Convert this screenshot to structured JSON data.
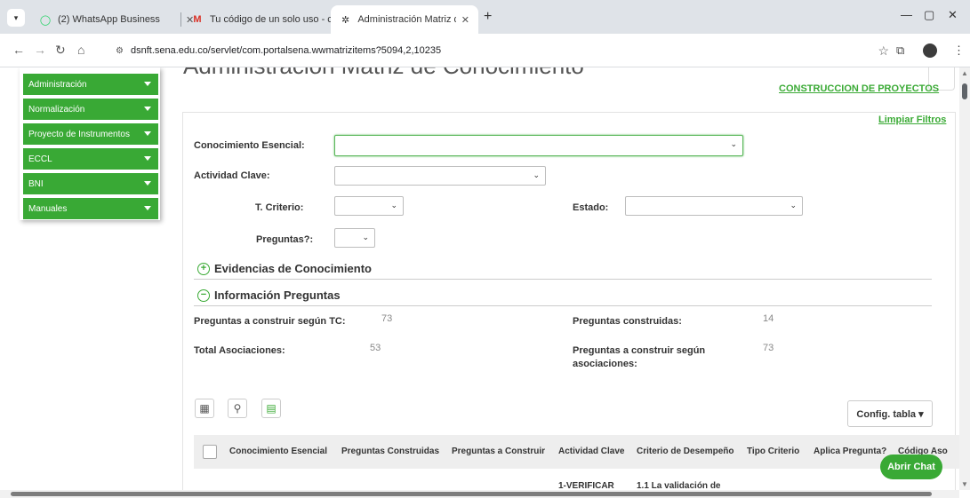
{
  "browser": {
    "tabs": [
      {
        "title": "(2) WhatsApp Business",
        "icon": "whatsapp-icon"
      },
      {
        "title": "Tu código de un solo uso - cla",
        "icon": "gmail-icon"
      },
      {
        "title": "Administración Matriz de Cono",
        "icon": "sena-icon"
      }
    ],
    "url": "dsnft.sena.edu.co/servlet/com.portalsena.wwmatrizitems?5094,2,10235"
  },
  "page": {
    "title": "Administración Matriz de Conocimiento",
    "project_link": "CONSTRUCCION DE PROYECTOS",
    "clear_filters": "Limpiar Filtros"
  },
  "sidebar": {
    "items": [
      {
        "label": "Administración"
      },
      {
        "label": "Normalización"
      },
      {
        "label": "Proyecto de Instrumentos"
      },
      {
        "label": "ECCL"
      },
      {
        "label": "BNI"
      },
      {
        "label": "Manuales"
      }
    ]
  },
  "filters": {
    "conocimiento": {
      "label": "Conocimiento Esencial:",
      "value": ""
    },
    "actividad": {
      "label": "Actividad Clave:",
      "value": ""
    },
    "criterio": {
      "label": "T. Criterio:",
      "value": ""
    },
    "estado": {
      "label": "Estado:",
      "value": ""
    },
    "preguntas": {
      "label": "Preguntas?:",
      "value": ""
    }
  },
  "sections": {
    "evidencias": "Evidencias de Conocimiento",
    "informacion": "Información Preguntas"
  },
  "info": {
    "preguntas_tc": {
      "label": "Preguntas a construir según TC:",
      "value": "73"
    },
    "total_asoc": {
      "label": "Total Asociaciones:",
      "value": "53"
    },
    "construidas": {
      "label": "Preguntas construidas:",
      "value": "14"
    },
    "construir_asoc": {
      "label": "Preguntas a construir según asociaciones:",
      "value": "73"
    }
  },
  "toolbar": {
    "config_label": "Config. tabla ▾"
  },
  "table": {
    "columns": [
      "Conocimiento Esencial",
      "Preguntas Construidas",
      "Preguntas a Construir",
      "Actividad Clave",
      "Criterio de Desempeño",
      "Tipo Criterio",
      "Aplica Pregunta?",
      "Código Aso"
    ],
    "first_row": {
      "actividad": "1-VERIFICAR",
      "criterio": "1.1 La validación de"
    }
  },
  "chat": {
    "label": "Abrir Chat"
  },
  "colors": {
    "accent_green": "#39a935",
    "link_green": "#3aaa35"
  }
}
